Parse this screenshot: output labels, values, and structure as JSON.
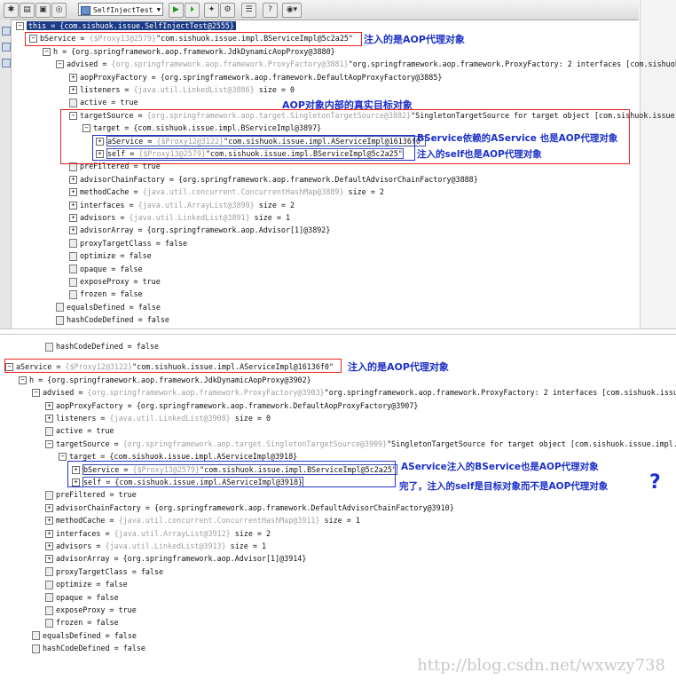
{
  "toolbar": {
    "config_name": "SelfInjectTest",
    "buttons": [
      "bug-icon",
      "new-icon",
      "console-icon",
      "watch-icon",
      "run-icon",
      "step-icon",
      "debug-icon",
      "stop-icon",
      "list-icon",
      "info-icon",
      "help-icon"
    ]
  },
  "panel1": {
    "rows": [
      {
        "indent": 0,
        "exp": "−",
        "label": "this = ",
        "gray": "",
        "text": "{com.sishuok.issue.SelfInjectTest@2555}",
        "hl": true
      },
      {
        "indent": 1,
        "exp": "−",
        "label": "bService = ",
        "gray": "{$Proxy13@2579}",
        "text": "\"com.sishuok.issue.impl.BServiceImpl@5c2a25\""
      },
      {
        "indent": 2,
        "exp": "−",
        "label": "h = ",
        "gray": "",
        "text": "{org.springframework.aop.framework.JdkDynamicAopProxy@3880}"
      },
      {
        "indent": 3,
        "exp": "−",
        "label": "advised = ",
        "gray": "{org.springframework.aop.framework.ProxyFactory@3881}",
        "text": "\"org.springframework.aop.framework.ProxyFactory: 2 interfaces [com.sishuok."
      },
      {
        "indent": 4,
        "exp": "+",
        "label": "aopProxyFactory = ",
        "gray": "",
        "text": "{org.springframework.aop.framework.DefaultAopProxyFactory@3885}"
      },
      {
        "indent": 4,
        "exp": "+",
        "label": "listeners = ",
        "gray": "{java.util.LinkedList@3886}",
        "text": " size = 0"
      },
      {
        "indent": 4,
        "exp": "",
        "label": "active = ",
        "gray": "",
        "text": "true"
      },
      {
        "indent": 4,
        "exp": "−",
        "label": "targetSource = ",
        "gray": "{org.springframework.aop.target.SingletonTargetSource@3882}",
        "text": "\"SingletonTargetSource for target object [com.sishuok.issue.i"
      },
      {
        "indent": 5,
        "exp": "−",
        "label": "target = ",
        "gray": "",
        "text": "{com.sishuok.issue.impl.BServiceImpl@3897}"
      },
      {
        "indent": 6,
        "exp": "+",
        "label": "aService = ",
        "gray": "{$Proxy12@3122}",
        "text": "\"com.sishuok.issue.impl.AServiceImpl@16136f0\"",
        "box": true
      },
      {
        "indent": 6,
        "exp": "+",
        "label": "self = ",
        "gray": "{$Proxy13@2579}",
        "text": "\"com.sishuok.issue.impl.BServiceImpl@5c2a25\"",
        "box": true
      },
      {
        "indent": 4,
        "exp": "",
        "label": "preFiltered = ",
        "gray": "",
        "text": "true"
      },
      {
        "indent": 4,
        "exp": "+",
        "label": "advisorChainFactory = ",
        "gray": "",
        "text": "{org.springframework.aop.framework.DefaultAdvisorChainFactory@3888}"
      },
      {
        "indent": 4,
        "exp": "+",
        "label": "methodCache = ",
        "gray": "{java.util.concurrent.ConcurrentHashMap@3889}",
        "text": " size = 2"
      },
      {
        "indent": 4,
        "exp": "+",
        "label": "interfaces = ",
        "gray": "{java.util.ArrayList@3890}",
        "text": " size = 2"
      },
      {
        "indent": 4,
        "exp": "+",
        "label": "advisors = ",
        "gray": "{java.util.LinkedList@3891}",
        "text": " size = 1"
      },
      {
        "indent": 4,
        "exp": "+",
        "label": "advisorArray = ",
        "gray": "",
        "text": "{org.springframework.aop.Advisor[1]@3892}"
      },
      {
        "indent": 4,
        "exp": "",
        "label": "proxyTargetClass = ",
        "gray": "",
        "text": "false"
      },
      {
        "indent": 4,
        "exp": "",
        "label": "optimize = ",
        "gray": "",
        "text": "false"
      },
      {
        "indent": 4,
        "exp": "",
        "label": "opaque = ",
        "gray": "",
        "text": "false"
      },
      {
        "indent": 4,
        "exp": "",
        "label": "exposeProxy = ",
        "gray": "",
        "text": "true"
      },
      {
        "indent": 4,
        "exp": "",
        "label": "frozen = ",
        "gray": "",
        "text": "false"
      },
      {
        "indent": 3,
        "exp": "",
        "label": "equalsDefined = ",
        "gray": "",
        "text": "false"
      },
      {
        "indent": 3,
        "exp": "",
        "label": "hashCodeDefined = ",
        "gray": "",
        "text": "false"
      }
    ],
    "annotations": {
      "a1": "注入的是AOP代理对象",
      "a2": "AOP对象内部的真实目标对象",
      "a3": "BService依赖的AService 也是AOP代理对象",
      "a4": "注入的self也是AOP代理对象"
    }
  },
  "panel2": {
    "rows": [
      {
        "indent": 3,
        "exp": "",
        "label": "hashCodeDefined = ",
        "gray": "",
        "text": "false",
        "clip": true
      },
      {
        "indent": 0,
        "exp": "−",
        "label": "aService = ",
        "gray": "{$Proxy12@3122}",
        "text": "\"com.sishuok.issue.impl.AServiceImpl@16136f0\""
      },
      {
        "indent": 1,
        "exp": "−",
        "label": "h = ",
        "gray": "",
        "text": "{org.springframework.aop.framework.JdkDynamicAopProxy@3902}"
      },
      {
        "indent": 2,
        "exp": "−",
        "label": "advised = ",
        "gray": "{org.springframework.aop.framework.ProxyFactory@3903}",
        "text": "\"org.springframework.aop.framework.ProxyFactory: 2 interfaces [com.sishuok.issue."
      },
      {
        "indent": 3,
        "exp": "+",
        "label": "aopProxyFactory = ",
        "gray": "",
        "text": "{org.springframework.aop.framework.DefaultAopProxyFactory@3907}"
      },
      {
        "indent": 3,
        "exp": "+",
        "label": "listeners = ",
        "gray": "{java.util.LinkedList@3908}",
        "text": " size = 0"
      },
      {
        "indent": 3,
        "exp": "",
        "label": "active = ",
        "gray": "",
        "text": "true"
      },
      {
        "indent": 3,
        "exp": "−",
        "label": "targetSource = ",
        "gray": "{org.springframework.aop.target.SingletonTargetSource@3909}",
        "text": "\"SingletonTargetSource for target object [com.sishuok.issue.impl.A"
      },
      {
        "indent": 4,
        "exp": "−",
        "label": "target = ",
        "gray": "",
        "text": "{com.sishuok.issue.impl.AServiceImpl@3918}"
      },
      {
        "indent": 5,
        "exp": "+",
        "label": "bService = ",
        "gray": "{$Proxy13@2579}",
        "text": "\"com.sishuok.issue.impl.BServiceImpl@5c2a25\"",
        "box": true
      },
      {
        "indent": 5,
        "exp": "+",
        "label": "self = ",
        "gray": "",
        "text": "{com.sishuok.issue.impl.AServiceImpl@3918}",
        "box": true
      },
      {
        "indent": 3,
        "exp": "",
        "label": "preFiltered = ",
        "gray": "",
        "text": "true"
      },
      {
        "indent": 3,
        "exp": "+",
        "label": "advisorChainFactory = ",
        "gray": "",
        "text": "{org.springframework.aop.framework.DefaultAdvisorChainFactory@3910}"
      },
      {
        "indent": 3,
        "exp": "+",
        "label": "methodCache = ",
        "gray": "{java.util.concurrent.ConcurrentHashMap@3911}",
        "text": " size = 1"
      },
      {
        "indent": 3,
        "exp": "+",
        "label": "interfaces = ",
        "gray": "{java.util.ArrayList@3912}",
        "text": " size = 2"
      },
      {
        "indent": 3,
        "exp": "+",
        "label": "advisors = ",
        "gray": "{java.util.LinkedList@3913}",
        "text": " size = 1"
      },
      {
        "indent": 3,
        "exp": "+",
        "label": "advisorArray = ",
        "gray": "",
        "text": "{org.springframework.aop.Advisor[1]@3914}"
      },
      {
        "indent": 3,
        "exp": "",
        "label": "proxyTargetClass = ",
        "gray": "",
        "text": "false"
      },
      {
        "indent": 3,
        "exp": "",
        "label": "optimize = ",
        "gray": "",
        "text": "false"
      },
      {
        "indent": 3,
        "exp": "",
        "label": "opaque = ",
        "gray": "",
        "text": "false"
      },
      {
        "indent": 3,
        "exp": "",
        "label": "exposeProxy = ",
        "gray": "",
        "text": "true"
      },
      {
        "indent": 3,
        "exp": "",
        "label": "frozen = ",
        "gray": "",
        "text": "false"
      },
      {
        "indent": 2,
        "exp": "",
        "label": "equalsDefined = ",
        "gray": "",
        "text": "false"
      },
      {
        "indent": 2,
        "exp": "",
        "label": "hashCodeDefined = ",
        "gray": "",
        "text": "false"
      }
    ],
    "annotations": {
      "b1": "注入的是AOP代理对象",
      "b2": "AService注入的BService也是AOP代理对象",
      "b3": "完了，注入的self是目标对象而不是AOP代理对象",
      "qmark": "?"
    }
  },
  "watermark": "http://blog.csdn.net/wxwzy738",
  "colors": {
    "annotation": "#1b2fc9",
    "highlight": "#1c3b86",
    "red_box": "#e22222",
    "gray_text": "#a0a0a0"
  }
}
